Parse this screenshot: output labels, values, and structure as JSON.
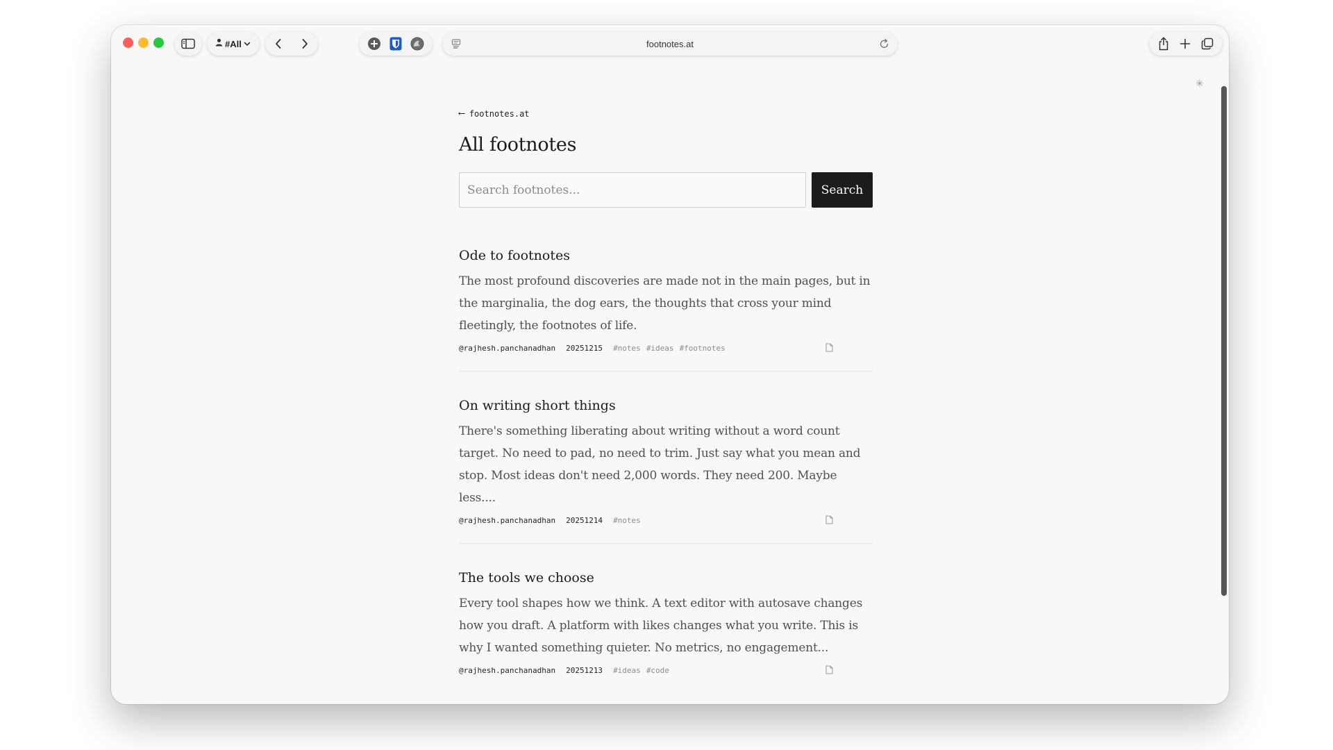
{
  "browser": {
    "profile_label": "#All",
    "url": "footnotes.at"
  },
  "page": {
    "back_link": "footnotes.at",
    "title": "All footnotes",
    "search": {
      "placeholder": "Search footnotes...",
      "button_label": "Search"
    },
    "posts": [
      {
        "title": "Ode to footnotes",
        "excerpt": "The most profound discoveries are made not in the main pages, but in the marginalia, the dog ears, the thoughts that cross your mind fleetingly, the footnotes of life.",
        "author": "@rajhesh.panchanadhan",
        "date": "20251215",
        "tags": [
          "#notes",
          "#ideas",
          "#footnotes"
        ]
      },
      {
        "title": "On writing short things",
        "excerpt": "There's something liberating about writing without a word count target. No need to pad, no need to trim. Just say what you mean and stop. Most ideas don't need 2,000 words. They need 200. Maybe less....",
        "author": "@rajhesh.panchanadhan",
        "date": "20251214",
        "tags": [
          "#notes"
        ]
      },
      {
        "title": "The tools we choose",
        "excerpt": "Every tool shapes how we think. A text editor with autosave changes how you draft. A platform with likes changes what you write. This is why I wanted something quieter. No metrics, no engagement...",
        "author": "@rajhesh.panchanadhan",
        "date": "20251213",
        "tags": [
          "#ideas",
          "#code"
        ]
      }
    ]
  },
  "icons": {
    "sidebar": "sidebar-icon",
    "profile": "person-icon",
    "back": "chevron-left-icon",
    "forward": "chevron-right-icon",
    "extension1": "plus-circle-icon",
    "extension2": "shield-icon",
    "extension3": "avatar-icon",
    "page_action": "page-menu-icon",
    "reload": "reload-icon",
    "share": "share-icon",
    "new_tab": "plus-icon",
    "tabs": "tabs-overview-icon",
    "sparkle": "sparkle-icon",
    "copy": "document-icon"
  },
  "colors": {
    "window_bg": "#f8f8f8",
    "button_bg": "#1c1c1c",
    "text": "#1a1a1a",
    "muted": "#8c8c8c"
  }
}
